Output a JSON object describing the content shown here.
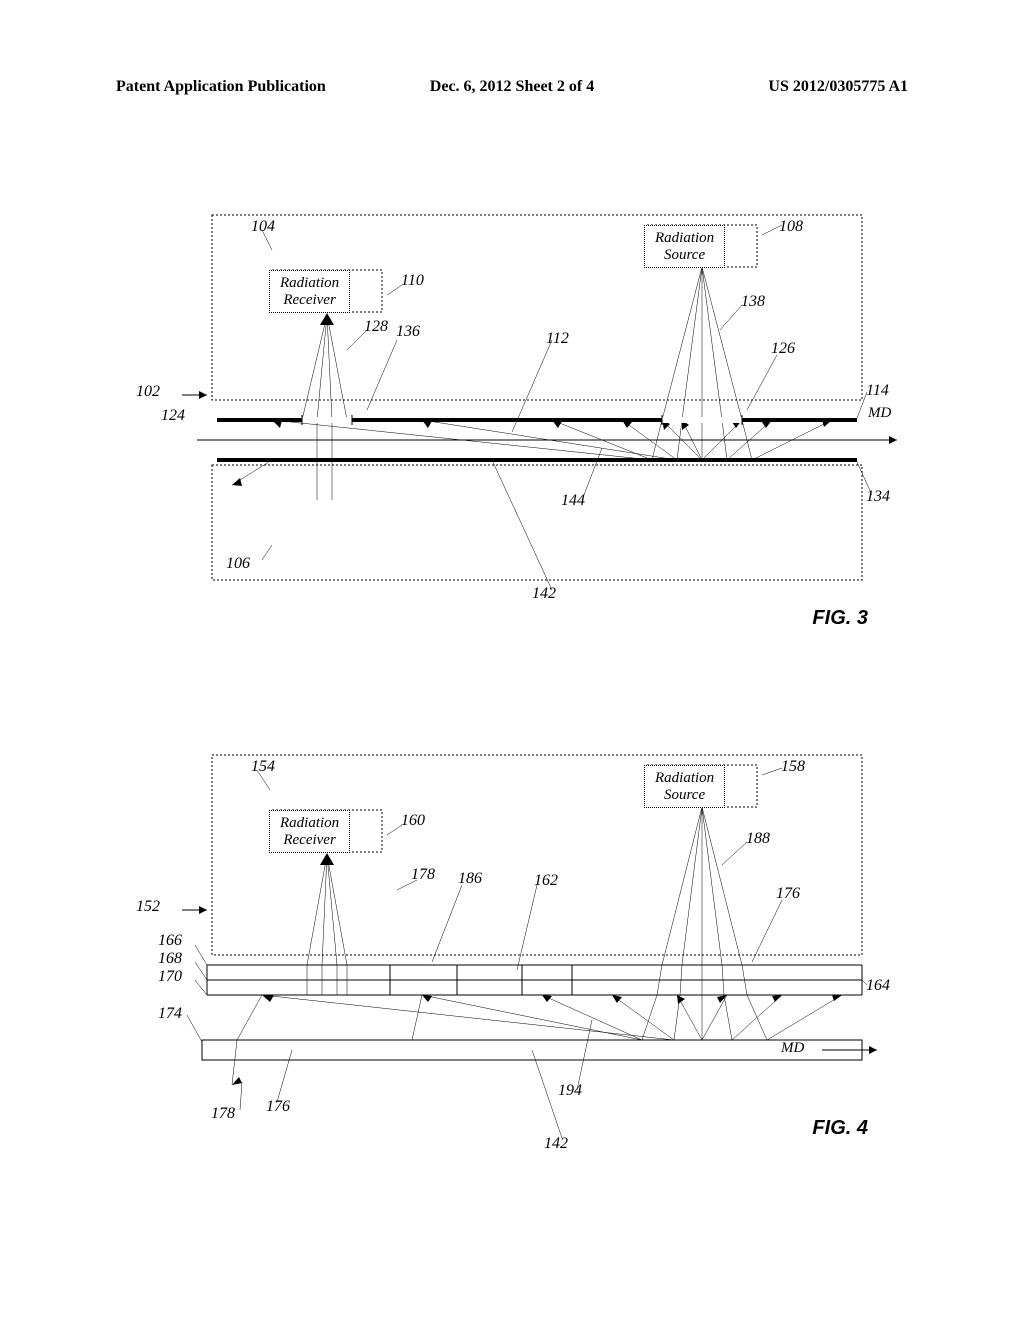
{
  "header": {
    "left": "Patent Application Publication",
    "center": "Dec. 6, 2012   Sheet 2 of 4",
    "right": "US 2012/0305775 A1"
  },
  "figure3": {
    "label": "FIG. 3",
    "radiation_source": "Radiation\nSource",
    "radiation_receiver": "Radiation\nReceiver",
    "refs": {
      "r102": "102",
      "r104": "104",
      "r106": "106",
      "r108": "108",
      "r110": "110",
      "r112": "112",
      "r114": "114",
      "r124": "124",
      "r126": "126",
      "r128": "128",
      "r134": "134",
      "r136": "136",
      "r138": "138",
      "r142": "142",
      "r144": "144",
      "md": "MD"
    }
  },
  "figure4": {
    "label": "FIG. 4",
    "radiation_source": "Radiation\nSource",
    "radiation_receiver": "Radiation\nReceiver",
    "refs": {
      "r142": "142",
      "r152": "152",
      "r154": "154",
      "r158": "158",
      "r160": "160",
      "r162": "162",
      "r164": "164",
      "r166": "166",
      "r168": "168",
      "r170": "170",
      "r174": "174",
      "r176a": "176",
      "r176b": "176",
      "r178a": "178",
      "r178b": "178",
      "r186": "186",
      "r188": "188",
      "r194": "194",
      "md": "MD"
    }
  }
}
